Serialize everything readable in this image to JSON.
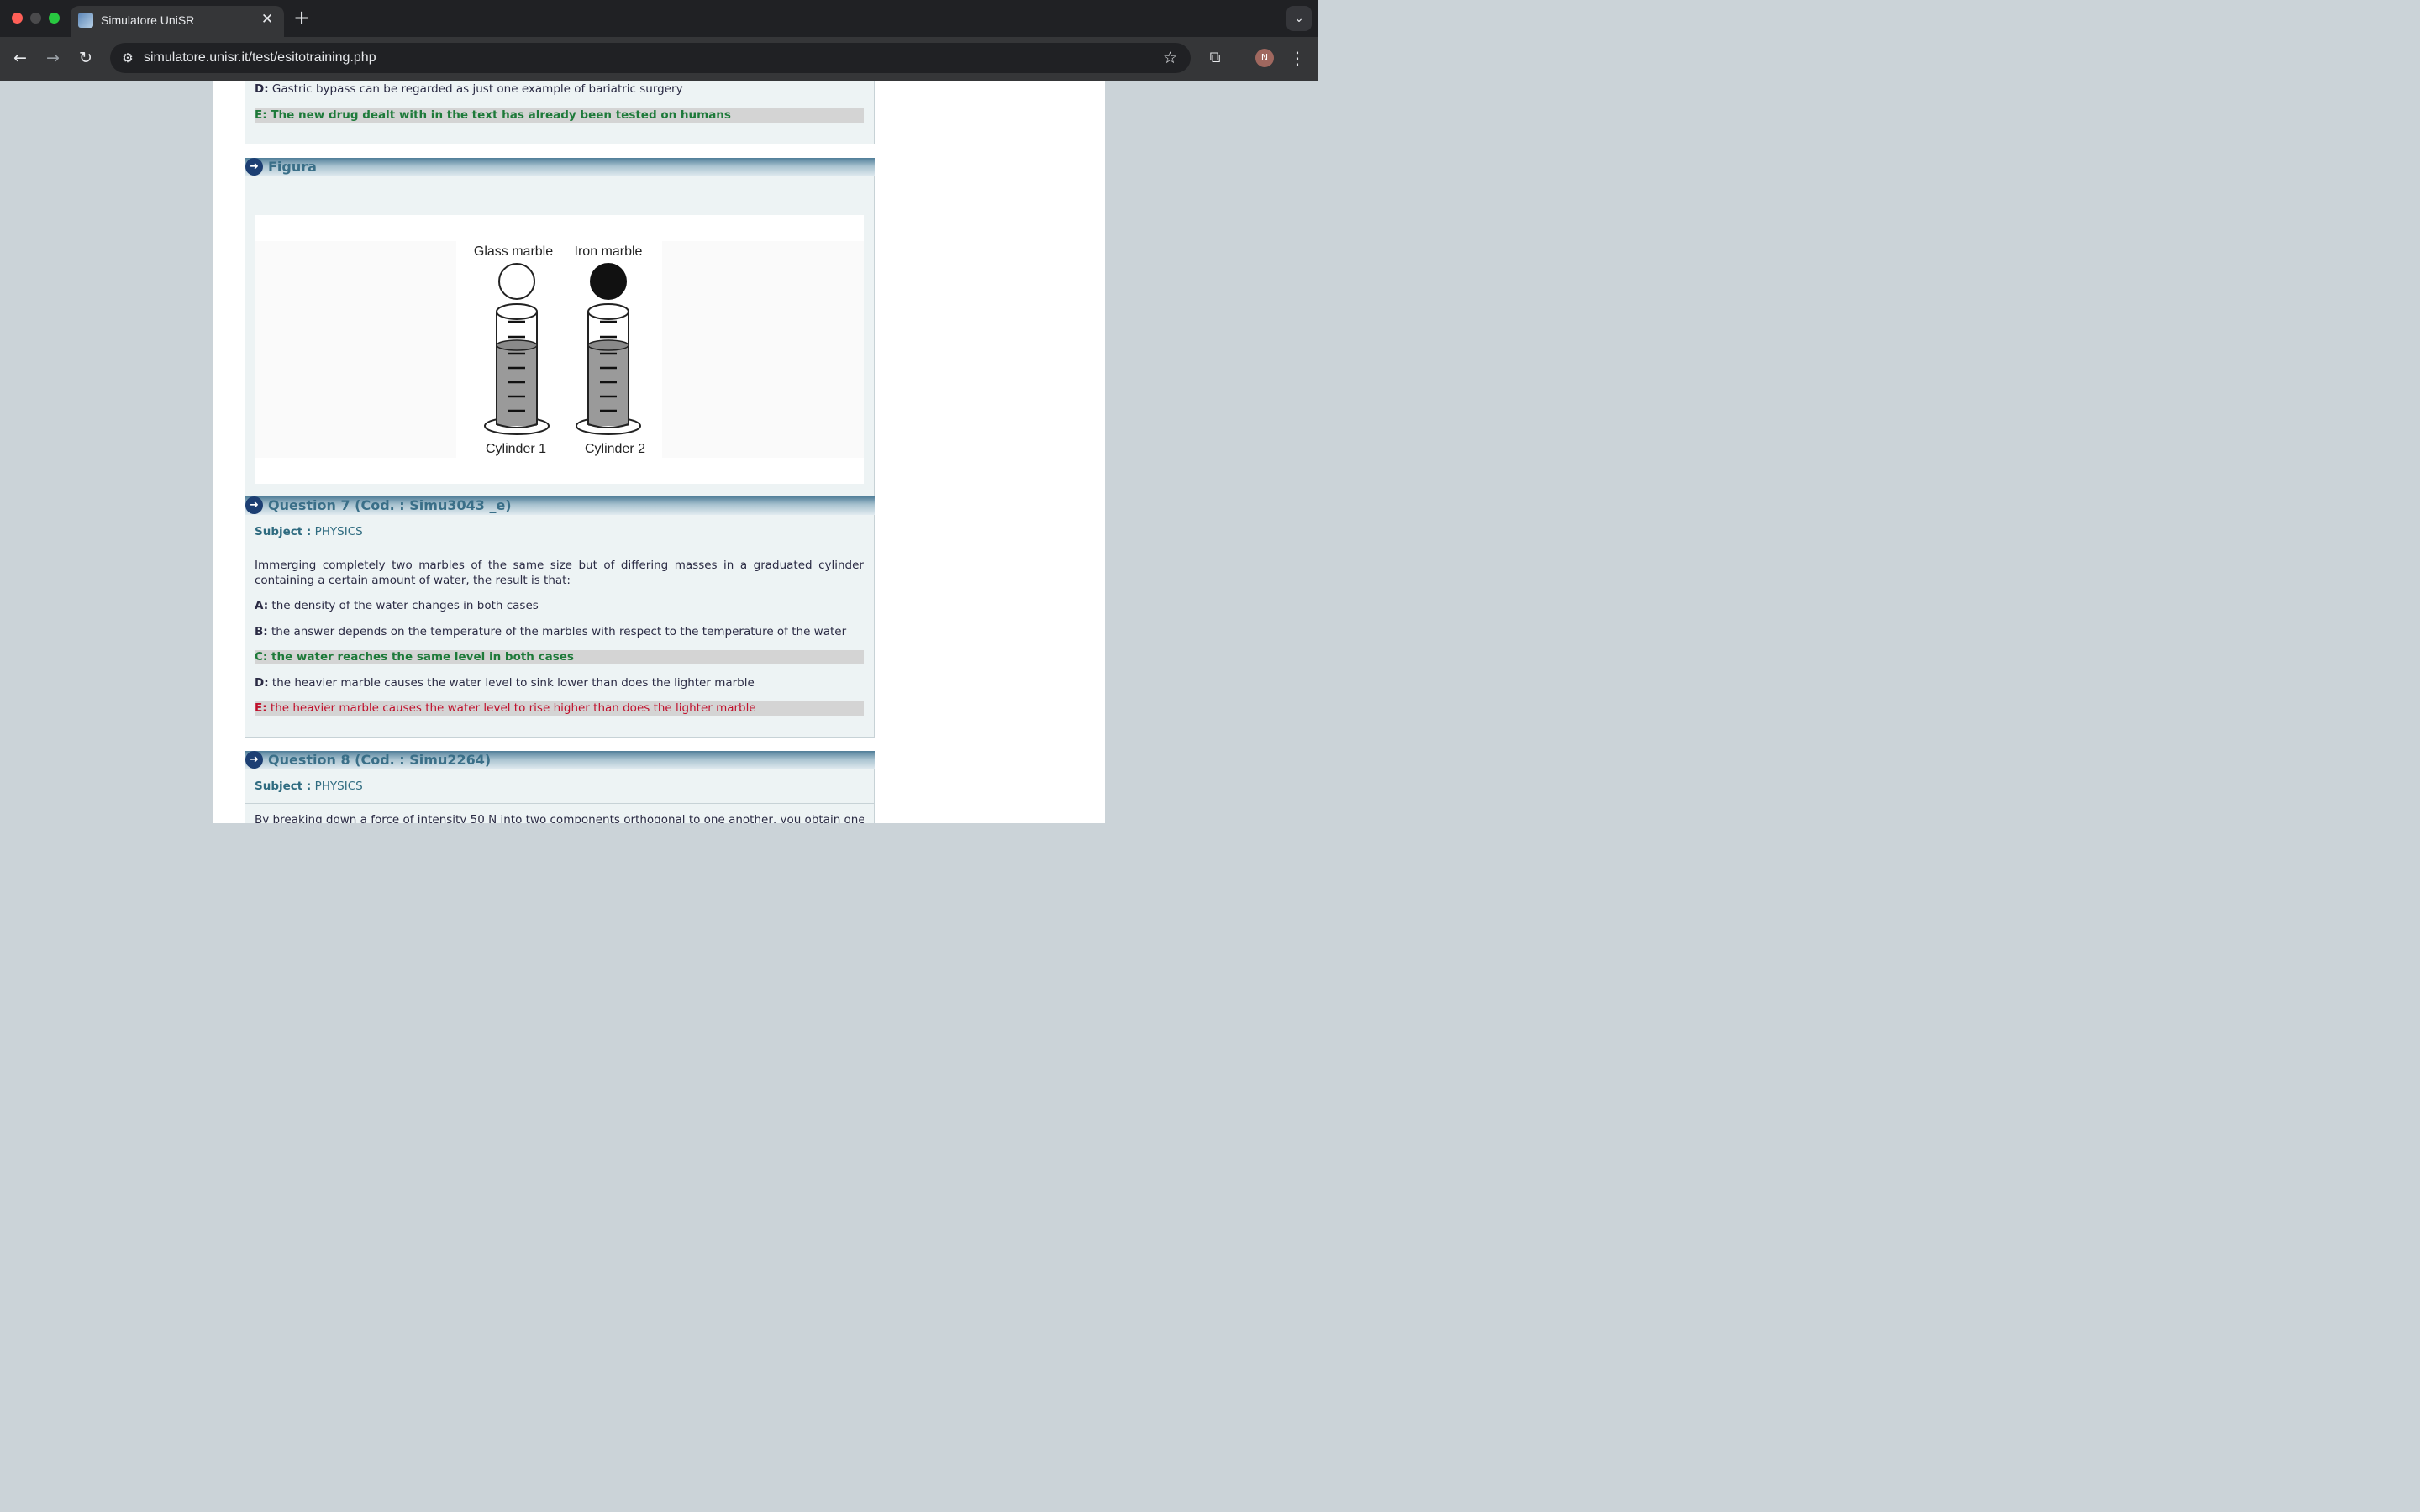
{
  "browser": {
    "tab_title": "Simulatore UniSR",
    "tab_close": "✕",
    "new_tab": "+",
    "url": "simulatore.unisr.it/test/esitotraining.php",
    "avatar_initial": "N"
  },
  "prev_question": {
    "options": [
      {
        "letter": "D:",
        "text": "Gastric bypass can be regarded as just one example of bariatric surgery",
        "status": "normal"
      },
      {
        "letter": "E:",
        "text": "The new drug dealt with in the text has already been tested on humans",
        "status": "correct"
      }
    ]
  },
  "figure": {
    "header": "Figura",
    "labels": {
      "glass": "Glass marble",
      "iron": "Iron marble",
      "cyl1": "Cylinder 1",
      "cyl2": "Cylinder 2"
    }
  },
  "question7": {
    "header": "Question 7 (Cod. : Simu3043 _e)",
    "subject_label": "Subject :",
    "subject": "PHYSICS",
    "text": "Immerging completely two marbles of the same size but of differing masses in a graduated cylinder containing a certain amount of water, the result is that:",
    "options": [
      {
        "letter": "A:",
        "text": "the density of the water changes in both cases",
        "status": "normal"
      },
      {
        "letter": "B:",
        "text": "the answer depends on the temperature of the marbles with respect to the temperature of the water",
        "status": "normal"
      },
      {
        "letter": "C:",
        "text": "the water reaches the same level in both cases",
        "status": "correct"
      },
      {
        "letter": "D:",
        "text": "the heavier marble causes the water level to sink lower than does the lighter marble",
        "status": "normal"
      },
      {
        "letter": "E:",
        "text": "the heavier marble causes the water level to rise higher than does the lighter marble",
        "status": "wrong"
      }
    ]
  },
  "question8": {
    "header": "Question 8 (Cod. : Simu2264)",
    "subject_label": "Subject :",
    "subject": "PHYSICS",
    "text": "By breaking down a force of intensity 50 N into two components orthogonal to one another, you obtain one"
  },
  "colors": {
    "correct": "#1e7a3a",
    "wrong": "#c0102c",
    "header_text": "#3a6f88"
  }
}
